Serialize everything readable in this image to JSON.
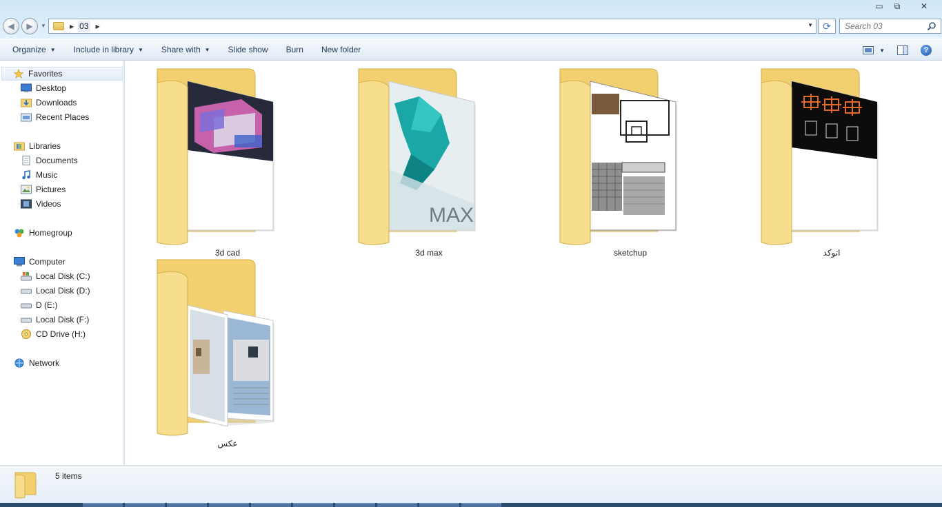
{
  "window": {
    "controls": {
      "minimize": "▭",
      "maximize": "⧉",
      "close": "✕"
    }
  },
  "address_bar": {
    "crumb": "03",
    "search_placeholder": "Search 03"
  },
  "toolbar": {
    "organize": "Organize",
    "include_in_library": "Include in library",
    "share_with": "Share with",
    "slide_show": "Slide show",
    "burn": "Burn",
    "new_folder": "New folder",
    "help": "?"
  },
  "sidebar": {
    "favorites": "Favorites",
    "desktop": "Desktop",
    "downloads": "Downloads",
    "recent_places": "Recent Places",
    "libraries": "Libraries",
    "documents": "Documents",
    "music": "Music",
    "pictures": "Pictures",
    "videos": "Videos",
    "homegroup": "Homegroup",
    "computer": "Computer",
    "disk_c": "Local Disk (C:)",
    "disk_d": "Local Disk (D:)",
    "disk_e": "D (E:)",
    "disk_f": "Local Disk (F:)",
    "cd_drive": "CD Drive (H:)",
    "network": "Network"
  },
  "folders": [
    {
      "name": "3d cad",
      "preview": "3d-render-dark"
    },
    {
      "name": "3d max",
      "preview": "3dsmax-logo",
      "preview_text": "MAX"
    },
    {
      "name": "sketchup",
      "preview": "elevation-drawing"
    },
    {
      "name": "اتوکد",
      "preview": "autocad-plans"
    },
    {
      "name": "عکس",
      "preview": "building-photos"
    }
  ],
  "details": {
    "item_count": "5 items"
  },
  "colors": {
    "folder_front": "#f7de8e",
    "folder_back": "#f2d06f",
    "selection_blue": "#3a70b5",
    "command_text": "#1e395b"
  }
}
